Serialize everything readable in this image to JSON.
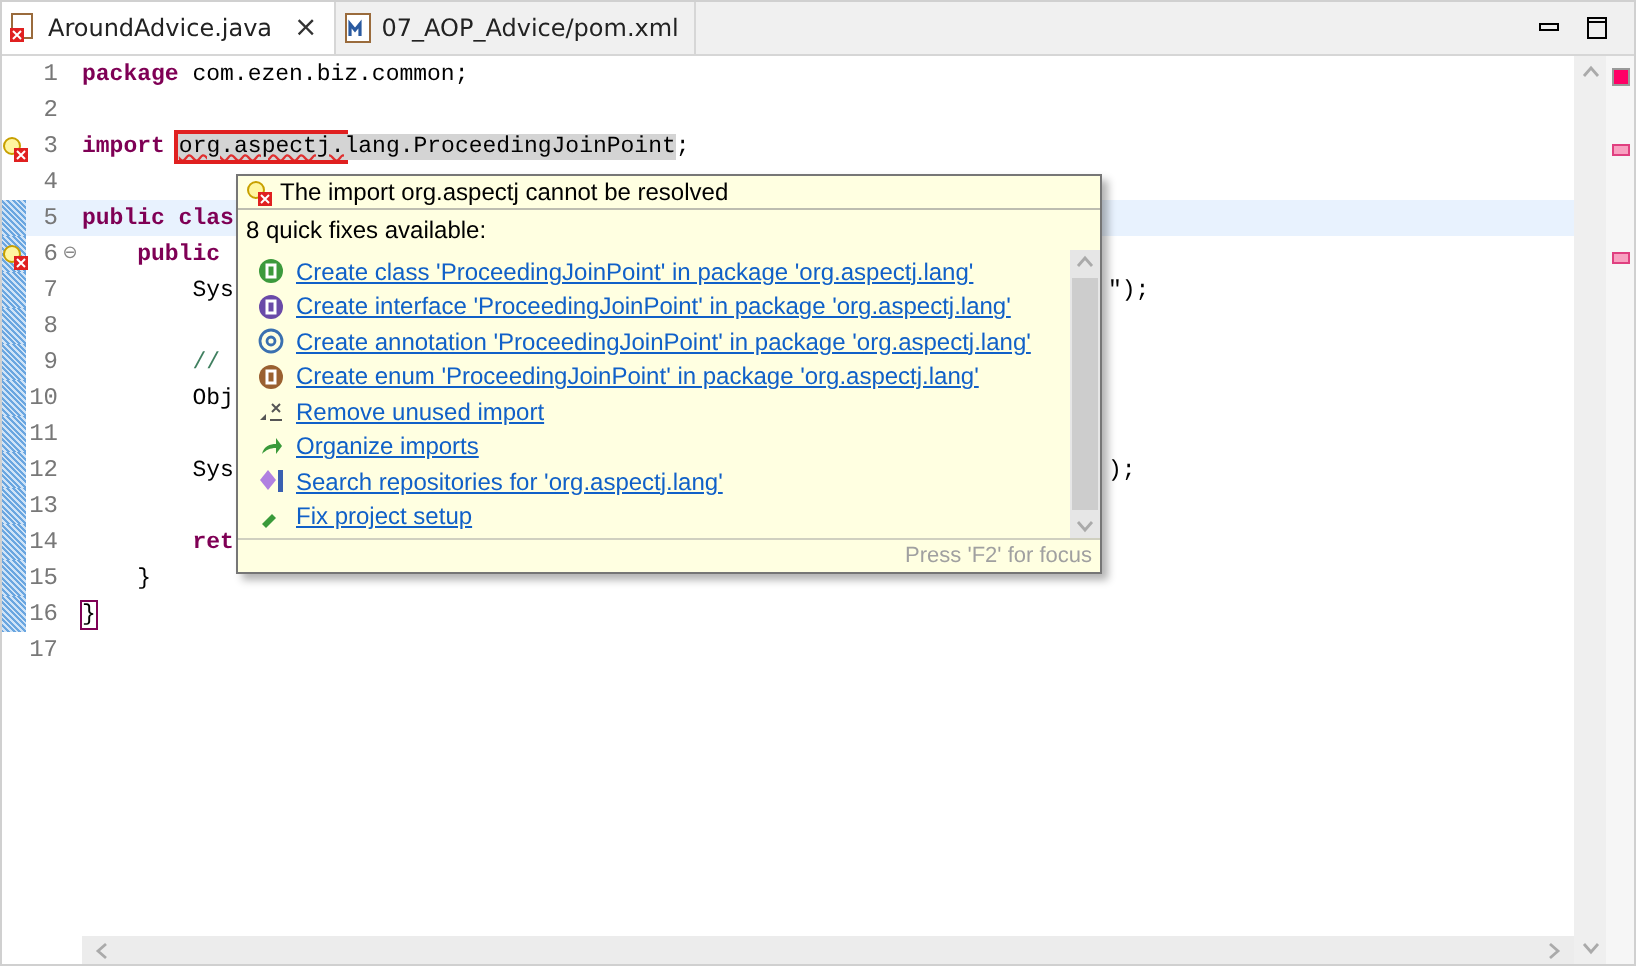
{
  "tabs": [
    {
      "label": "AroundAdvice.java",
      "kind": "java",
      "selected": true,
      "close": "×"
    },
    {
      "label": "07_AOP_Advice/pom.xml",
      "kind": "maven",
      "selected": false
    }
  ],
  "editor": {
    "lines": [
      {
        "number": "1",
        "tokens": [
          {
            "text": "package",
            "kind": "keyword"
          },
          {
            "text": " com.ezen.biz.common;",
            "kind": "plain"
          }
        ]
      },
      {
        "number": "2"
      },
      {
        "number": "3",
        "error": true,
        "tokens": [
          {
            "text": "import",
            "kind": "keyword"
          },
          {
            "text": "org.aspectj.",
            "kind": "flagged"
          },
          {
            "text": "lang.ProceedingJoinPoint",
            "kind": "occurrence"
          },
          {
            "text": ";",
            "kind": "plain"
          }
        ]
      },
      {
        "number": "4"
      },
      {
        "number": "5",
        "current": true,
        "changed": true,
        "tokens": [
          {
            "text": "public clas",
            "kind": "keyword"
          }
        ]
      },
      {
        "number": "6",
        "error": true,
        "fold": "⊖",
        "changed": true,
        "tokens": [
          {
            "text": "    public",
            "kind": "keyword"
          }
        ]
      },
      {
        "number": "7",
        "changed": true,
        "tokens": [
          {
            "text": "        Sys",
            "kind": "plain"
          }
        ],
        "tail": "\");"
      },
      {
        "number": "8",
        "changed": true
      },
      {
        "number": "9",
        "changed": true,
        "tokens": [
          {
            "text": "        //",
            "kind": "comment"
          }
        ]
      },
      {
        "number": "10",
        "changed": true,
        "tokens": [
          {
            "text": "        Obj",
            "kind": "plain"
          }
        ]
      },
      {
        "number": "11",
        "changed": true
      },
      {
        "number": "12",
        "changed": true,
        "tokens": [
          {
            "text": "        Sys",
            "kind": "plain"
          }
        ],
        "tail": ");"
      },
      {
        "number": "13",
        "changed": true
      },
      {
        "number": "14",
        "changed": true,
        "tokens": [
          {
            "text": "        ret",
            "kind": "keyword"
          }
        ]
      },
      {
        "number": "15",
        "changed": true,
        "tokens": [
          {
            "text": "    }",
            "kind": "plain"
          }
        ]
      },
      {
        "number": "16",
        "changed": true,
        "tokens": [
          {
            "text": "}",
            "kind": "bracket"
          }
        ]
      },
      {
        "number": "17"
      }
    ]
  },
  "quick_fix_popup": {
    "problem": "The import org.aspectj cannot be resolved",
    "count_label": "8 quick fixes available:",
    "fixes": [
      {
        "kind": "class",
        "label": "Create class 'ProceedingJoinPoint' in package 'org.aspectj.lang'"
      },
      {
        "kind": "interface",
        "label": "Create interface 'ProceedingJoinPoint' in package 'org.aspectj.lang'"
      },
      {
        "kind": "annotation",
        "label": "Create annotation 'ProceedingJoinPoint' in package 'org.aspectj.lang'"
      },
      {
        "kind": "enum",
        "label": "Create enum 'ProceedingJoinPoint' in package 'org.aspectj.lang'"
      },
      {
        "kind": "remove",
        "label": "Remove unused import"
      },
      {
        "kind": "organize",
        "label": "Organize imports"
      },
      {
        "kind": "search",
        "label": "Search repositories for 'org.aspectj.lang'"
      },
      {
        "kind": "setup",
        "label": "Fix project setup"
      }
    ],
    "footer": "Press 'F2' for focus"
  }
}
